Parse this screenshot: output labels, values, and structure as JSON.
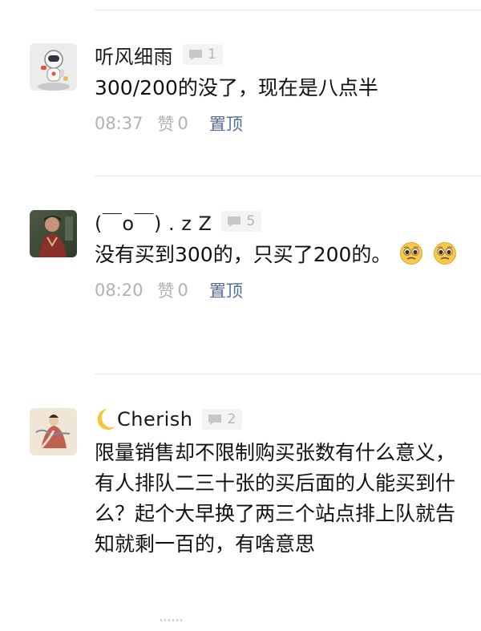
{
  "comments": [
    {
      "name": "听风细雨",
      "reply_count": "1",
      "text": "300/200的没了，现在是八点半",
      "time": "08:37",
      "like_label": "赞",
      "like_count": "0",
      "pin_label": "置顶",
      "avatar_icon": "astronaut-avatar-icon"
    },
    {
      "name": "(￣o￣) . z Z",
      "reply_count": "5",
      "text": "没有买到300的，只买了200的。",
      "emoji": "pleading-face-emoji",
      "time": "08:20",
      "like_label": "赞",
      "like_count": "0",
      "pin_label": "置顶",
      "avatar_icon": "person-photo-avatar-icon"
    },
    {
      "name": "Cherish",
      "name_icon": "crescent-moon-emoji",
      "reply_count": "2",
      "text": "限量销售却不限制购买张数有什么意义，有人排队二三十张的买后面的人能买到什么？起个大早换了两三个站点排上队就告知就剩一百的，有啥意思",
      "avatar_icon": "painting-avatar-icon"
    }
  ],
  "colors": {
    "link": "#576b95",
    "meta": "#b2b2b2",
    "badge_bg": "#f3f3f3",
    "divider": "#e7e7e7"
  }
}
